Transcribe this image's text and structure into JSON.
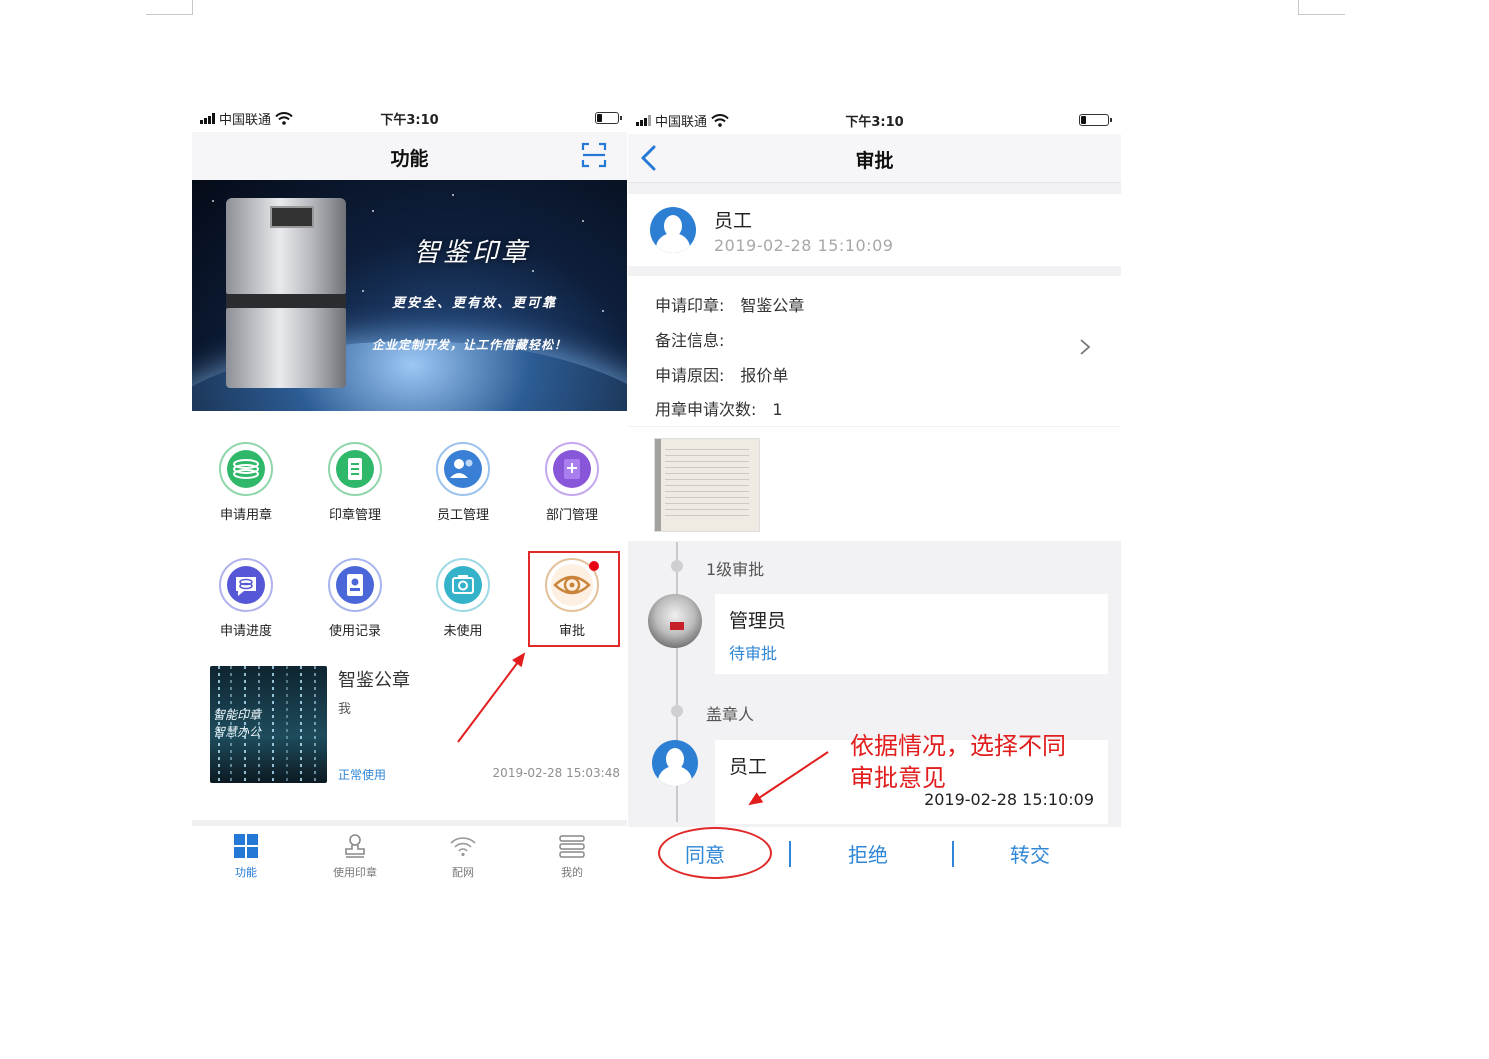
{
  "left_screen": {
    "status_bar": {
      "carrier": "中国联通",
      "time": "下午3:10"
    },
    "nav": {
      "title": "功能"
    },
    "banner": {
      "title": "智鉴印章",
      "line1": "更安全、更有效、更可靠",
      "line2": "企业定制开发，让工作借藏轻松！"
    },
    "grid": [
      {
        "label": "申请用章",
        "icon": "stack-icon",
        "color": "#2fb86a"
      },
      {
        "label": "印章管理",
        "icon": "document-icon",
        "color": "#2fb86a"
      },
      {
        "label": "员工管理",
        "icon": "people-icon",
        "color": "#3a7fd6"
      },
      {
        "label": "部门管理",
        "icon": "folder-plus-icon",
        "color": "#8856d8"
      },
      {
        "label": "申请进度",
        "icon": "chat-progress-icon",
        "color": "#5657d6"
      },
      {
        "label": "使用记录",
        "icon": "record-icon",
        "color": "#4a66d8"
      },
      {
        "label": "未使用",
        "icon": "camera-icon",
        "color": "#33b2c9"
      },
      {
        "label": "审批",
        "icon": "eye-icon",
        "color": "#c9843b"
      }
    ],
    "card": {
      "name": "智鉴公章",
      "owner": "我",
      "status": "正常使用",
      "date": "2019-02-28 15:03:48",
      "thumb_text1": "智能印章",
      "thumb_text2": "智慧办公"
    },
    "tabs": [
      {
        "label": "功能",
        "icon": "grid-icon",
        "active": true
      },
      {
        "label": "使用印章",
        "icon": "stamp-icon",
        "active": false
      },
      {
        "label": "配网",
        "icon": "wifi-icon",
        "active": false
      },
      {
        "label": "我的",
        "icon": "menu-icon",
        "active": false
      }
    ]
  },
  "right_screen": {
    "status_bar": {
      "carrier": "中国联通",
      "time": "下午3:10"
    },
    "nav": {
      "title": "审批"
    },
    "applicant": {
      "name": "员工",
      "date": "2019-02-28 15:10:09"
    },
    "info": [
      {
        "key": "申请印章:",
        "value": "智鉴公章"
      },
      {
        "key": "备注信息:",
        "value": ""
      },
      {
        "key": "申请原因:",
        "value": "报价单"
      },
      {
        "key": "用章申请次数:",
        "value": "1"
      }
    ],
    "timeline": {
      "level1_label": "1级审批",
      "approver_name": "管理员",
      "approver_status": "待审批",
      "stamper_label": "盖章人",
      "stamper_name": "员工",
      "stamper_date": "2019-02-28 15:10:09"
    },
    "actions": {
      "agree": "同意",
      "reject": "拒绝",
      "transfer": "转交"
    }
  },
  "annotation": {
    "line1": "依据情况，选择不同",
    "line2": "审批意见"
  },
  "colors": {
    "accent": "#2f86d6",
    "annotation_red": "#e11d1d"
  }
}
